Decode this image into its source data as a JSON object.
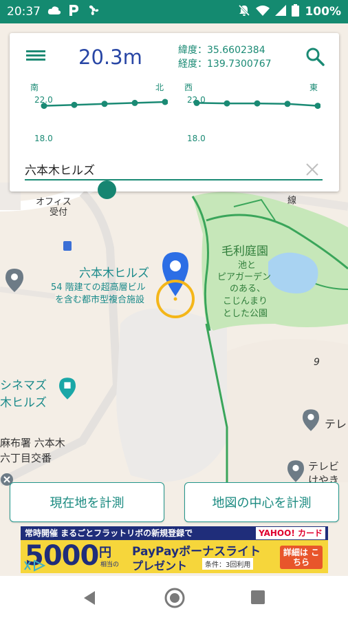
{
  "status_bar": {
    "time": "20:37",
    "battery": "100%",
    "icons": [
      "cloud-icon",
      "parking-icon",
      "fan-icon",
      "mute-icon",
      "wifi-icon",
      "signal-icon",
      "battery-icon"
    ]
  },
  "measurement": {
    "distance": "20.3m",
    "latitude": "緯度：35.6602384",
    "longitude": "経度：139.7300767"
  },
  "chart_ns": {
    "left_label": "南",
    "right_label": "北",
    "top_value": "22.0",
    "bottom_value": "18.0"
  },
  "chart_ew": {
    "left_label": "西",
    "right_label": "東",
    "top_value": "22.0",
    "bottom_value": "18.0"
  },
  "chart_data": [
    {
      "type": "line",
      "x": [
        "南",
        "",
        "",
        "",
        "北"
      ],
      "values": [
        20.6,
        20.7,
        20.8,
        20.9,
        21.0
      ],
      "ylim": [
        18.0,
        22.0
      ]
    },
    {
      "type": "line",
      "x": [
        "西",
        "",
        "",
        "",
        "東"
      ],
      "values": [
        20.9,
        20.85,
        20.85,
        20.8,
        20.6
      ],
      "ylim": [
        18.0,
        22.0
      ]
    }
  ],
  "place_input": {
    "value": "六本木ヒルズ"
  },
  "map": {
    "labels": {
      "office": "オフィス",
      "reception": "受付",
      "roppongi_hills": "六本木ヒルズ",
      "desc_1": "54 階建ての超高層ビル",
      "desc_2": "を含む都市型複合施設",
      "mori_garden": "毛利庭園",
      "garden_desc_1": "池と",
      "garden_desc_2": "ピアガーデン",
      "garden_desc_3": "のある、",
      "garden_desc_4": "こじんまり",
      "garden_desc_5": "とした公園",
      "cinemas_1": "シネマズ",
      "cinemas_2": "木ヒルズ",
      "police_1": "麻布署 六本木",
      "police_2": "六丁目交番",
      "tv": "テレ",
      "tv2_1": "テレビ",
      "tv2_2": "けやき",
      "num9": "9",
      "road": "線"
    },
    "accent_colors": {
      "pin": "#2c6ee5",
      "accuracy_ring": "#f4b619",
      "park": "#c3e6b6",
      "road_green": "#3aa55a"
    }
  },
  "buttons": {
    "measure_current": "現在地を計測",
    "measure_center": "地図の中心を計測"
  },
  "ad": {
    "banner_top": "常時開催 まるごとフラットリボの新規登録で",
    "yahoo": "YAHOO! カード",
    "amount": "5000",
    "unit": "円",
    "unit_sub": "相当の",
    "headline": "PayPayボーナスライト",
    "headline2": "プレゼント",
    "condition": "条件：3回利用",
    "detail": "詳細は こちら"
  }
}
